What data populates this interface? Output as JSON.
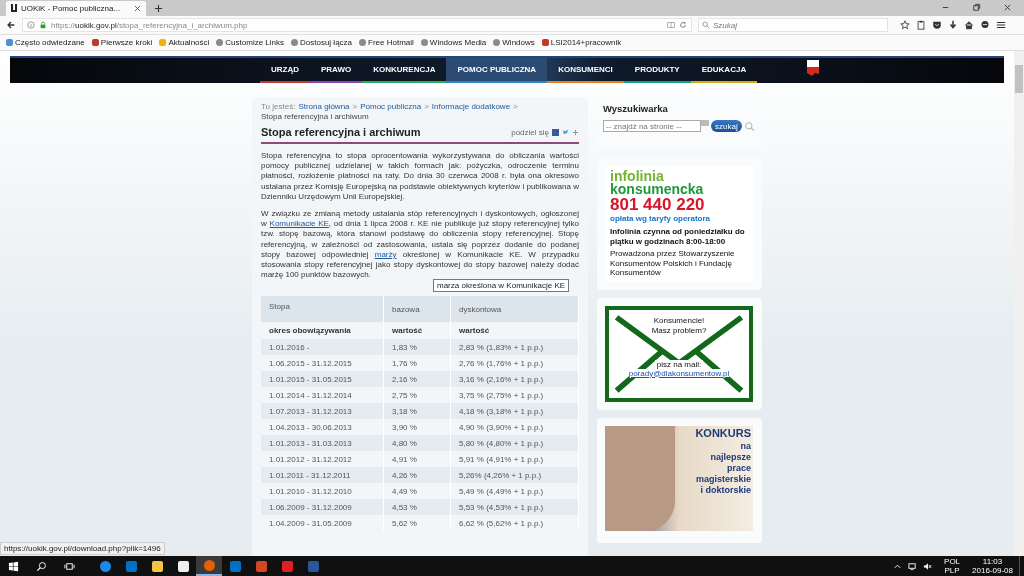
{
  "browser": {
    "tabs": [
      {
        "title": "UOKiK - Pomoc publiczna...",
        "selected": true
      }
    ],
    "url": "https://**uokik.gov.pl**/stopa_referencyjna_i_archiwum.php",
    "search_placeholder": "Szukaj",
    "bookmarks": [
      {
        "label": "Często odwiedzane",
        "kind": "folder"
      },
      {
        "label": "Pierwsze kroki",
        "kind": "firefox"
      },
      {
        "label": "Aktualności",
        "kind": "feed"
      },
      {
        "label": "Customize Links",
        "kind": "globe"
      },
      {
        "label": "Dostosuj łącza",
        "kind": "globe"
      },
      {
        "label": "Free Hotmail",
        "kind": "globe"
      },
      {
        "label": "Windows Media",
        "kind": "globe"
      },
      {
        "label": "Windows",
        "kind": "globe"
      },
      {
        "label": "LSI2014+pracownik",
        "kind": "shield"
      }
    ]
  },
  "site_nav": [
    {
      "label": "URZĄD",
      "selected": false,
      "color": "#c0392b"
    },
    {
      "label": "PRAWO",
      "selected": false,
      "color": "#8e44ad"
    },
    {
      "label": "KONKURENCJA",
      "selected": false,
      "color": "#27ae60"
    },
    {
      "label": "POMOC PUBLICZNA",
      "selected": true,
      "color": "#2e86c1"
    },
    {
      "label": "KONSUMENCI",
      "selected": false,
      "color": "#e67e22"
    },
    {
      "label": "PRODUKTY",
      "selected": false,
      "color": "#16a085"
    },
    {
      "label": "EDUKACJA",
      "selected": false,
      "color": "#d4ac0d"
    }
  ],
  "breadcrumb": {
    "prefix": "Tu jesteś:",
    "separator": ">",
    "links": [
      "Strona główna",
      "Pomoc publiczna",
      "Informacje dodatkowe"
    ],
    "current": "Stopa referencyjna i archiwum"
  },
  "article": {
    "title": "Stopa referencyjna i archiwum",
    "share_label": "podziel się",
    "paragraphs": [
      [
        {
          "text": "Stopa referencyjna to stopa oprocentowania wykorzystywana do obliczania wartości pomocy publicznej udzielanej w takich formach jak: pożyczka, odroczenie terminu płatności, rozłożenie płatności na raty. Do dnia 30 czerwca 2008 r. była ona okresowo ustalana przez Komisję Europejską na podstawie obiektywnych kryteriów i publikowana w Dzienniku Urzędowym Unii Europejskiej.",
          "link": false
        }
      ],
      [
        {
          "text": "W związku ze zmianą metody ustalania stóp referencyjnych i dyskontowych, ogłoszonej w ",
          "link": false
        },
        {
          "text": "Komunikacie KE",
          "link": true
        },
        {
          "text": ", od dnia 1 lipca 2008 r. KE nie publikuje już stopy referencyjnej tylko tzw. stopę bazową, która stanowi podstawę do obliczenia stopy referencyjnej. Stopę referencyjną, w zależności od zastosowania, ustala się poprzez dodanie do podanej stopy bazowej odpowiedniej ",
          "link": false
        },
        {
          "text": "marży",
          "link": true
        },
        {
          "text": " określonej w Komunikacie KE. W przypadku stosowania stopy referencyjnej jako stopy dyskontowej do stopy bazowej należy dodać marżę 100 punktów bazowych.",
          "link": false
        }
      ]
    ],
    "tooltip": "marza określona w Komunikacje KE"
  },
  "table": {
    "header": [
      "Stopa",
      "bazowa",
      "dyskontowa"
    ],
    "subheader": [
      "okres obowiązywania",
      "wartość",
      "wartość"
    ],
    "rows": [
      [
        "1.01.2016 -",
        "1,83 %",
        "2,83 % (1,83% + 1 p.p.)"
      ],
      [
        "1.06.2015 - 31.12.2015",
        "1,76 %",
        "2,76 % (1,76% + 1 p.p.)"
      ],
      [
        "1.01.2015 - 31.05.2015",
        "2,16 %",
        "3,16 % (2,16% + 1 p.p.)"
      ],
      [
        "1.01.2014 - 31.12.2014",
        "2,75 %",
        "3,75 % (2,75% + 1 p.p.)"
      ],
      [
        "1.07.2013 - 31.12.2013",
        "3,18 %",
        "4,18 % (3,18% + 1 p.p.)"
      ],
      [
        "1.04.2013 - 30.06.2013",
        "3,90 %",
        "4,90 % (3,90% + 1 p.p.)"
      ],
      [
        "1.01.2013 - 31.03.2013",
        "4,80 %",
        "5,80 % (4,80% + 1 p.p.)"
      ],
      [
        "1.01.2012 - 31.12.2012",
        "4,91 %",
        "5,91 % (4,91% + 1 p.p.)"
      ],
      [
        "1.01.2011 - 31.12.2011",
        "4,26 %",
        "5,26% (4,26% + 1 p.p.)"
      ],
      [
        "1.01.2010 - 31.12.2010",
        "4,49 %",
        "5,49 % (4,49% + 1 p.p.)"
      ],
      [
        "1.06.2009 - 31.12.2009",
        "4,53 %",
        "5,53 % (4,53% + 1 p.p.)"
      ],
      [
        "1.04.2009 - 31.05.2009",
        "5,62 %",
        "6,62 % (5,62% + 1 p.p.)"
      ]
    ]
  },
  "sidebar": {
    "search": {
      "title": "Wyszukiwarka",
      "placeholder": "-- znajdź na stronie --",
      "button": "szukaj"
    },
    "hotline": {
      "line1": "infolinia",
      "line2": "konsumencka",
      "phone": "801 440 220",
      "fee": "opłata wg taryfy operatora",
      "hours": "Infolinia czynna od poniedziałku do piątku w godzinach 8:00-18:00",
      "operator": "Prowadzona przez Stowarzyszenie Konsumentów Polskich i Fundację Konsumentów"
    },
    "mail": {
      "heading": "Konsumencie! Masz problem?",
      "prompt": "pisz na mail:",
      "address": "porady@dlakonsumentow.pl"
    },
    "contest": {
      "title": "KONKURS",
      "lines": [
        "na",
        "najlepsze",
        "prace",
        "magisterskie",
        "i doktorskie"
      ]
    }
  },
  "status_link": "https://uokik.gov.pl/download.php?plik=1496",
  "taskbar": {
    "apps": [
      {
        "kind": "edge",
        "active": false
      },
      {
        "kind": "outlook",
        "active": false
      },
      {
        "kind": "explorer",
        "active": false
      },
      {
        "kind": "store",
        "active": false
      },
      {
        "kind": "firefox",
        "active": true
      },
      {
        "kind": "outlook",
        "active": false
      },
      {
        "kind": "powerpoint",
        "active": false
      },
      {
        "kind": "acrobat",
        "active": false
      },
      {
        "kind": "word",
        "active": false
      }
    ],
    "lang": "POL",
    "layout": "PLP",
    "time": "11:03",
    "date": "2016-09-08"
  }
}
